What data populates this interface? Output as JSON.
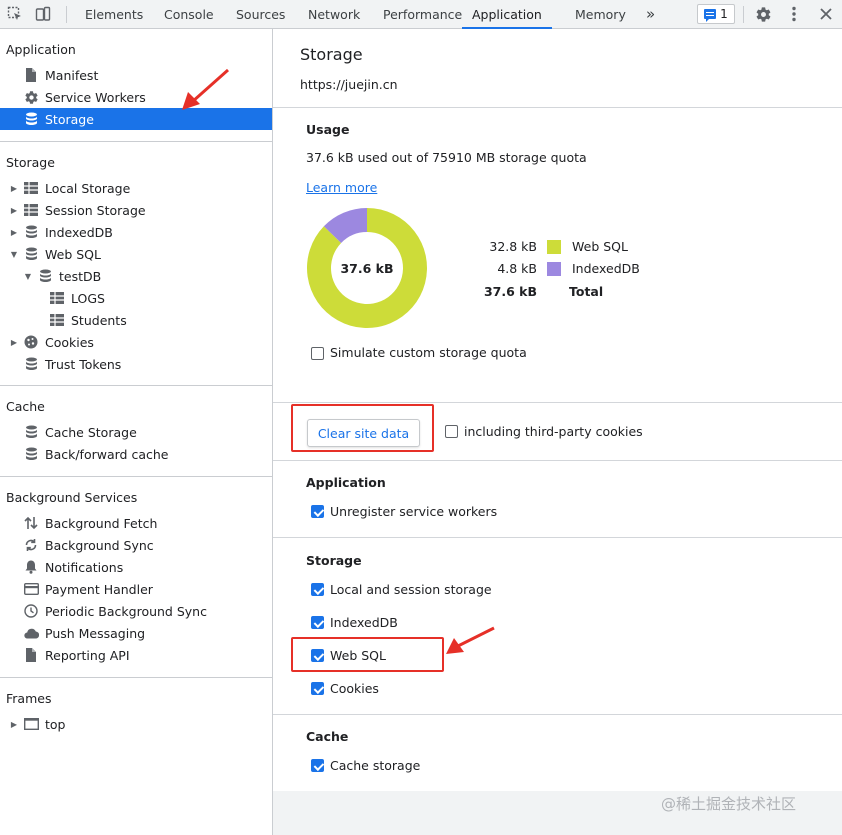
{
  "toolbar": {
    "tabs": [
      {
        "label": "Elements"
      },
      {
        "label": "Console"
      },
      {
        "label": "Sources"
      },
      {
        "label": "Network"
      },
      {
        "label": "Performance"
      },
      {
        "label": "Application",
        "active": true
      },
      {
        "label": "Memory"
      }
    ],
    "more_tabs_label": "»",
    "message_count": "1",
    "icons": [
      "inspect-icon",
      "device-toggle-icon",
      "message-icon",
      "gear-icon",
      "more-vert-icon",
      "close-icon"
    ]
  },
  "sidebar": {
    "application": {
      "title": "Application",
      "items": [
        {
          "label": "Manifest",
          "icon": "file-icon"
        },
        {
          "label": "Service Workers",
          "icon": "gear-icon"
        },
        {
          "label": "Storage",
          "icon": "database-icon",
          "selected": true
        }
      ]
    },
    "storage": {
      "title": "Storage",
      "items": [
        {
          "label": "Local Storage",
          "icon": "grid-icon"
        },
        {
          "label": "Session Storage",
          "icon": "grid-icon"
        },
        {
          "label": "IndexedDB",
          "icon": "database-icon"
        },
        {
          "label": "Web SQL",
          "icon": "database-icon"
        },
        {
          "label": "testDB",
          "icon": "database-icon"
        },
        {
          "label": "LOGS",
          "icon": "grid-icon"
        },
        {
          "label": "Students",
          "icon": "grid-icon"
        },
        {
          "label": "Cookies",
          "icon": "cookie-icon"
        },
        {
          "label": "Trust Tokens",
          "icon": "database-icon"
        }
      ]
    },
    "cache": {
      "title": "Cache",
      "items": [
        {
          "label": "Cache Storage",
          "icon": "database-icon"
        },
        {
          "label": "Back/forward cache",
          "icon": "database-icon"
        }
      ]
    },
    "background_services": {
      "title": "Background Services",
      "items": [
        {
          "label": "Background Fetch",
          "icon": "up-down-arrows-icon"
        },
        {
          "label": "Background Sync",
          "icon": "sync-icon"
        },
        {
          "label": "Notifications",
          "icon": "bell-icon"
        },
        {
          "label": "Payment Handler",
          "icon": "card-icon"
        },
        {
          "label": "Periodic Background Sync",
          "icon": "clock-icon"
        },
        {
          "label": "Push Messaging",
          "icon": "cloud-icon"
        },
        {
          "label": "Reporting API",
          "icon": "file-icon"
        }
      ]
    },
    "frames": {
      "title": "Frames",
      "items": [
        {
          "label": "top",
          "icon": "frame-icon"
        }
      ]
    }
  },
  "main": {
    "title": "Storage",
    "origin": "https://juejin.cn",
    "usage": {
      "heading": "Usage",
      "summary": "37.6 kB used out of 75910 MB storage quota",
      "learn_more": "Learn more",
      "center_label": "37.6 kB",
      "rows": [
        {
          "value": "32.8 kB",
          "label": "Web SQL",
          "color": "#cddc39"
        },
        {
          "value": "4.8 kB",
          "label": "IndexedDB",
          "color": "#9c88e0"
        },
        {
          "value": "37.6 kB",
          "label": "Total"
        }
      ],
      "simulate_quota_label": "Simulate custom storage quota",
      "simulate_quota_checked": false
    },
    "clear": {
      "button_label": "Clear site data",
      "third_party_label": "including third-party cookies",
      "third_party_checked": false
    },
    "application": {
      "heading": "Application",
      "options": [
        {
          "label": "Unregister service workers",
          "checked": true
        }
      ]
    },
    "storage": {
      "heading": "Storage",
      "options": [
        {
          "label": "Local and session storage",
          "checked": true
        },
        {
          "label": "IndexedDB",
          "checked": true
        },
        {
          "label": "Web SQL",
          "checked": true
        },
        {
          "label": "Cookies",
          "checked": true
        }
      ]
    },
    "cache": {
      "heading": "Cache",
      "options": [
        {
          "label": "Cache storage",
          "checked": true
        }
      ]
    },
    "watermark": "@稀土掘金技术社区"
  },
  "chart_data": {
    "type": "pie",
    "categories": [
      "Web SQL",
      "IndexedDB"
    ],
    "values": [
      32.8,
      4.8
    ],
    "unit": "kB",
    "total": 37.6,
    "colors": [
      "#cddc39",
      "#9c88e0"
    ]
  }
}
